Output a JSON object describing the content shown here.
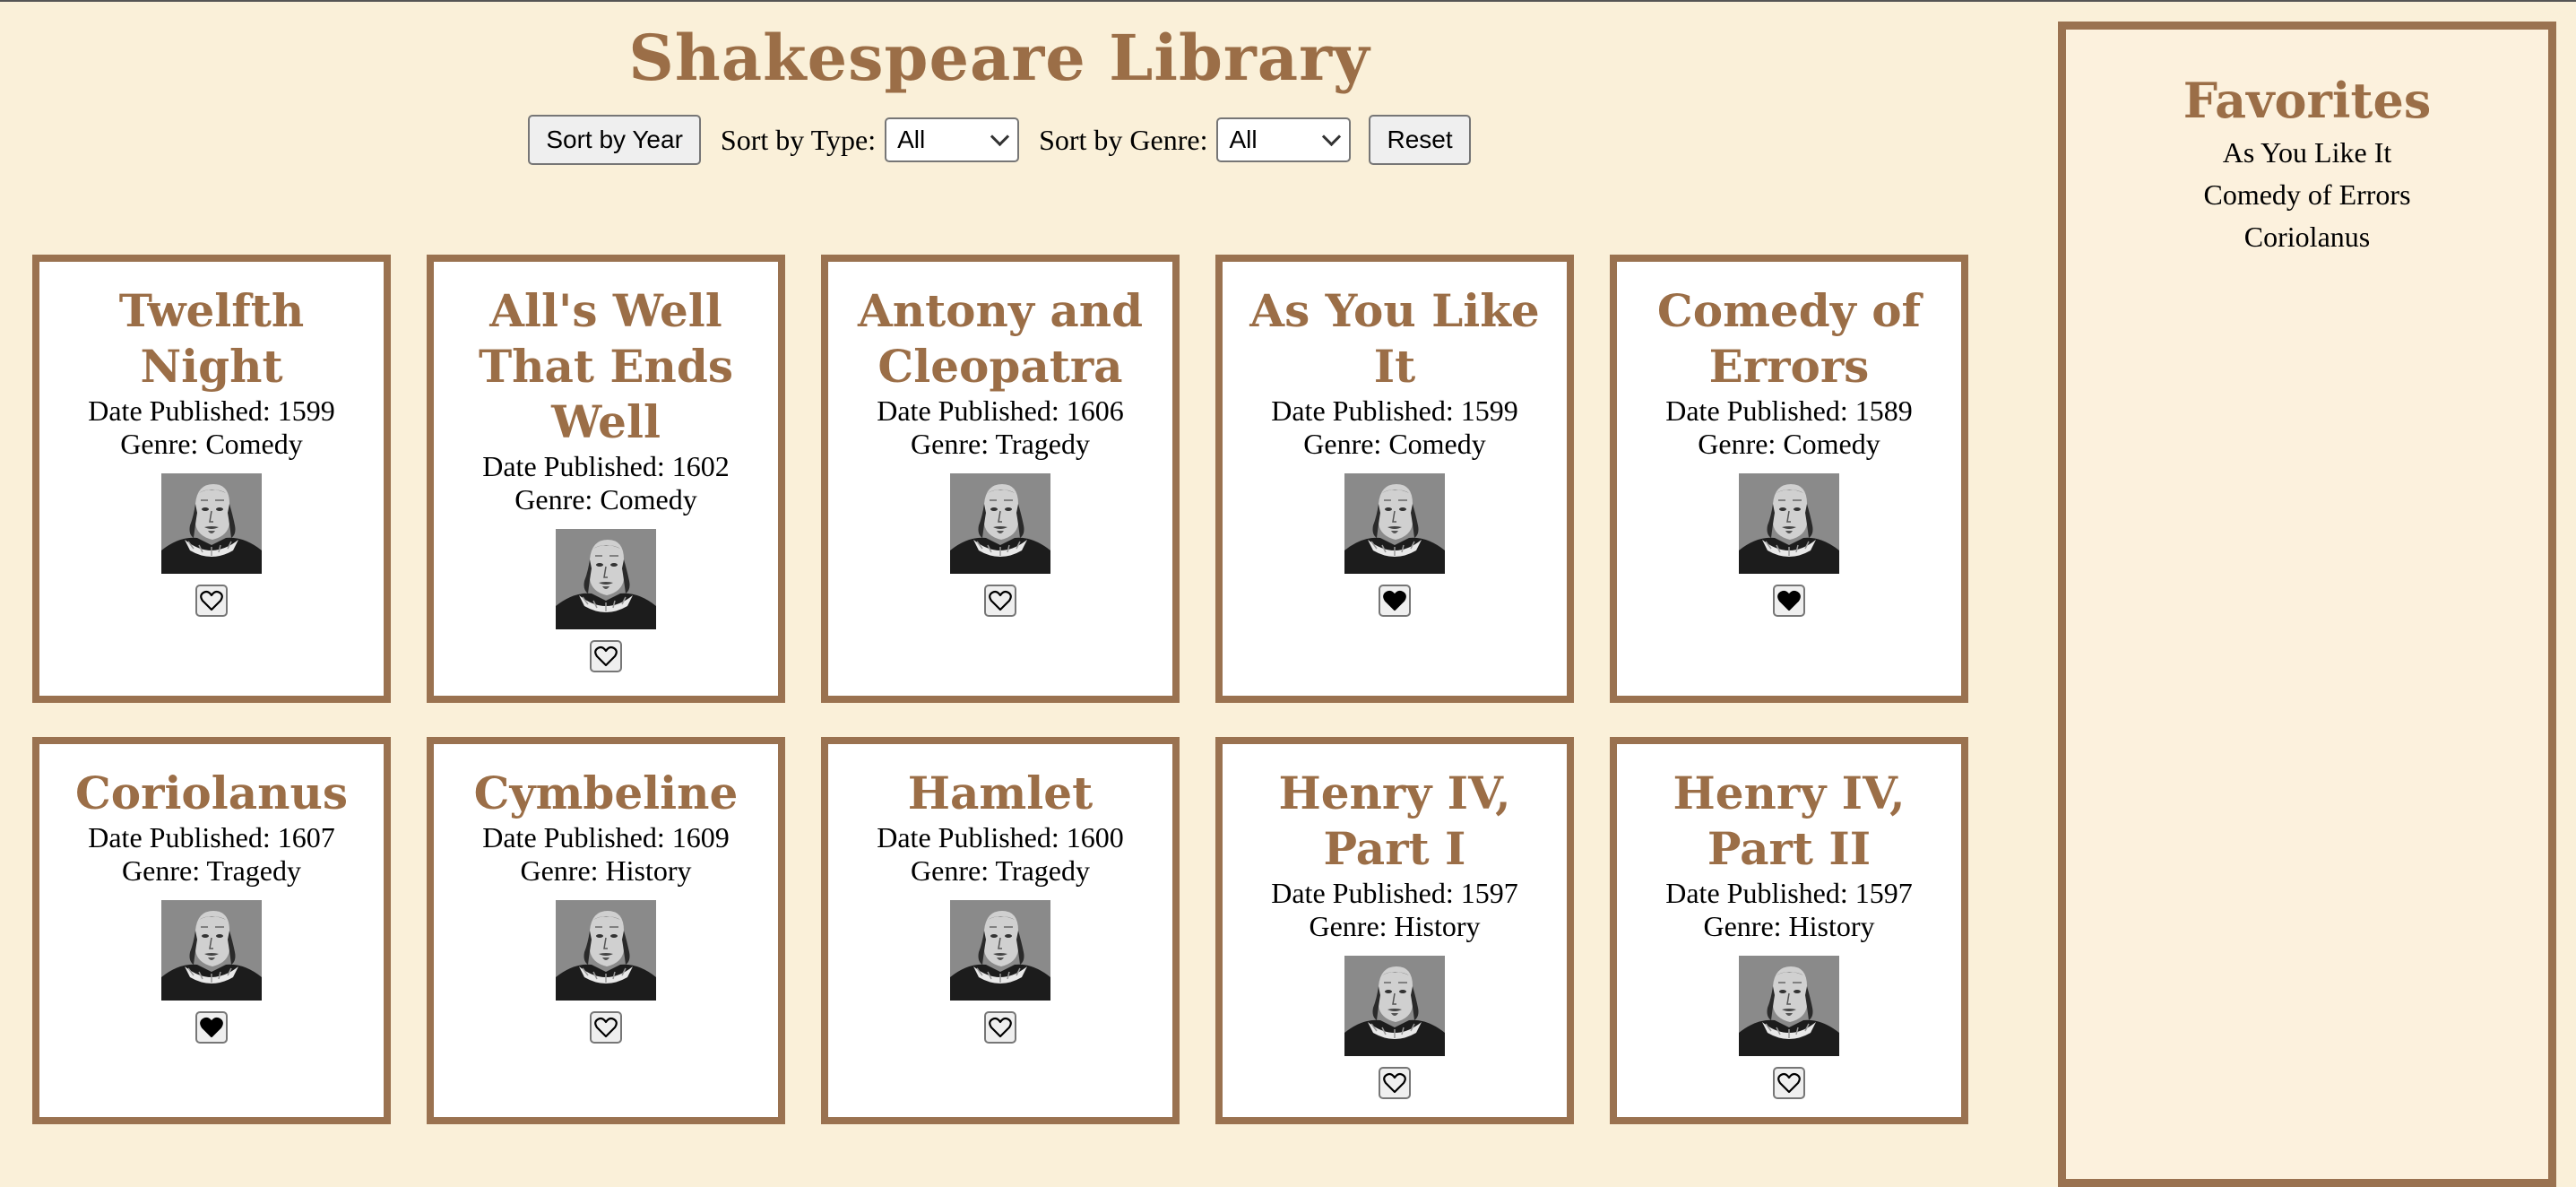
{
  "header": {
    "title": "Shakespeare Library"
  },
  "controls": {
    "sort_year_label": "Sort by Year",
    "type_label": "Sort by Type:",
    "type_value": "All",
    "genre_label": "Sort by Genre:",
    "genre_value": "All",
    "reset_label": "Reset"
  },
  "plays": [
    {
      "title": "Twelfth Night",
      "date": "Date Published: 1599",
      "genre": "Genre: Comedy",
      "favorite": false
    },
    {
      "title": "All's Well That Ends Well",
      "date": "Date Published: 1602",
      "genre": "Genre: Comedy",
      "favorite": false
    },
    {
      "title": "Antony and Cleopatra",
      "date": "Date Published: 1606",
      "genre": "Genre: Tragedy",
      "favorite": false
    },
    {
      "title": "As You Like It",
      "date": "Date Published: 1599",
      "genre": "Genre: Comedy",
      "favorite": true
    },
    {
      "title": "Comedy of Errors",
      "date": "Date Published: 1589",
      "genre": "Genre: Comedy",
      "favorite": true
    },
    {
      "title": "Coriolanus",
      "date": "Date Published: 1607",
      "genre": "Genre: Tragedy",
      "favorite": true
    },
    {
      "title": "Cymbeline",
      "date": "Date Published: 1609",
      "genre": "Genre: History",
      "favorite": false
    },
    {
      "title": "Hamlet",
      "date": "Date Published: 1600",
      "genre": "Genre: Tragedy",
      "favorite": false
    },
    {
      "title": "Henry IV, Part I",
      "date": "Date Published: 1597",
      "genre": "Genre: History",
      "favorite": false
    },
    {
      "title": "Henry IV, Part II",
      "date": "Date Published: 1597",
      "genre": "Genre: History",
      "favorite": false
    }
  ],
  "favorites": {
    "title": "Favorites",
    "items": [
      "As You Like It",
      "Comedy of Errors",
      "Coriolanus"
    ]
  },
  "icons": {
    "portrait": "shakespeare-portrait",
    "heart_empty": "heart-outline-icon",
    "heart_full": "heart-filled-icon"
  },
  "colors": {
    "accent": "#9b6e47",
    "border": "#9a7250",
    "background": "#faf0d9"
  }
}
